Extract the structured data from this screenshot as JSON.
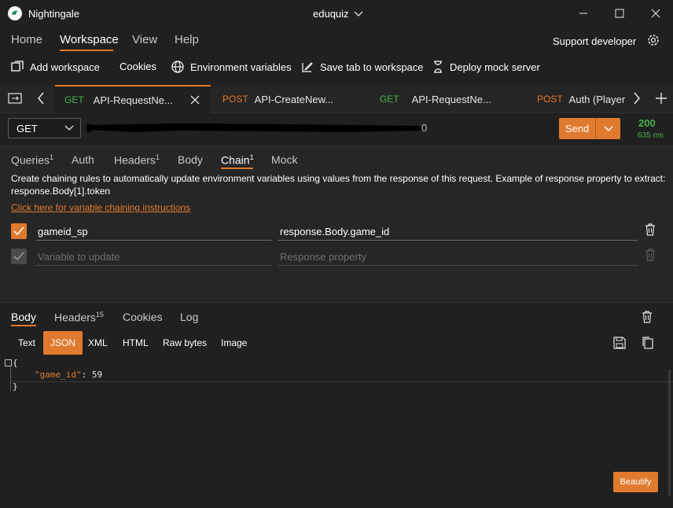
{
  "titlebar": {
    "app_name": "Nightingale",
    "workspace_name": "eduquiz"
  },
  "menu": {
    "home": "Home",
    "workspace": "Workspace",
    "view": "View",
    "help": "Help",
    "support": "Support developer"
  },
  "toolbar": {
    "add_workspace": "Add workspace",
    "cookies": "Cookies",
    "env_vars": "Environment variables",
    "save_tab": "Save tab to workspace",
    "deploy_mock": "Deploy mock server"
  },
  "tabs": [
    {
      "method": "GET",
      "title": "API-RequestNe..."
    },
    {
      "method": "POST",
      "title": "API-CreateNew..."
    },
    {
      "method": "GET",
      "title": "API-RequestNe..."
    },
    {
      "method": "POST",
      "title": "Auth (Player/a"
    }
  ],
  "request": {
    "method": "GET",
    "url_tail": "0",
    "send_label": "Send",
    "status_code": "200",
    "status_time": "635 ms"
  },
  "request_tabs": {
    "queries": "Queries",
    "queries_count": "1",
    "auth": "Auth",
    "headers": "Headers",
    "headers_count": "1",
    "body": "Body",
    "chain": "Chain",
    "chain_count": "1",
    "mock": "Mock"
  },
  "chain": {
    "description_line1": "Create chaining rules to automatically update environment variables using values from the response of this request. Example of response property to extract:",
    "description_line2": "response.Body[1].token",
    "instructions_link": "Click here for variable chaining instructions",
    "rows": [
      {
        "variable": "gameid_sp",
        "property": "response.Body.game_id",
        "checked": true
      }
    ],
    "new_row": {
      "variable_placeholder": "Variable to update",
      "property_placeholder": "Response property"
    }
  },
  "response_tabs": {
    "body": "Body",
    "headers": "Headers",
    "headers_count": "15",
    "cookies": "Cookies",
    "log": "Log"
  },
  "formats": [
    "Text",
    "JSON",
    "XML",
    "HTML",
    "Raw bytes",
    "Image"
  ],
  "selected_format": "JSON",
  "response_body": {
    "open_brace": "{",
    "key": "\"game_id\"",
    "colon": ": ",
    "value": "59",
    "close_brace": "}"
  },
  "beautify_label": "Beautify",
  "colors": {
    "accent": "#e07a2e",
    "get": "#46b14a",
    "post": "#e07a2e",
    "background": "#202020"
  }
}
